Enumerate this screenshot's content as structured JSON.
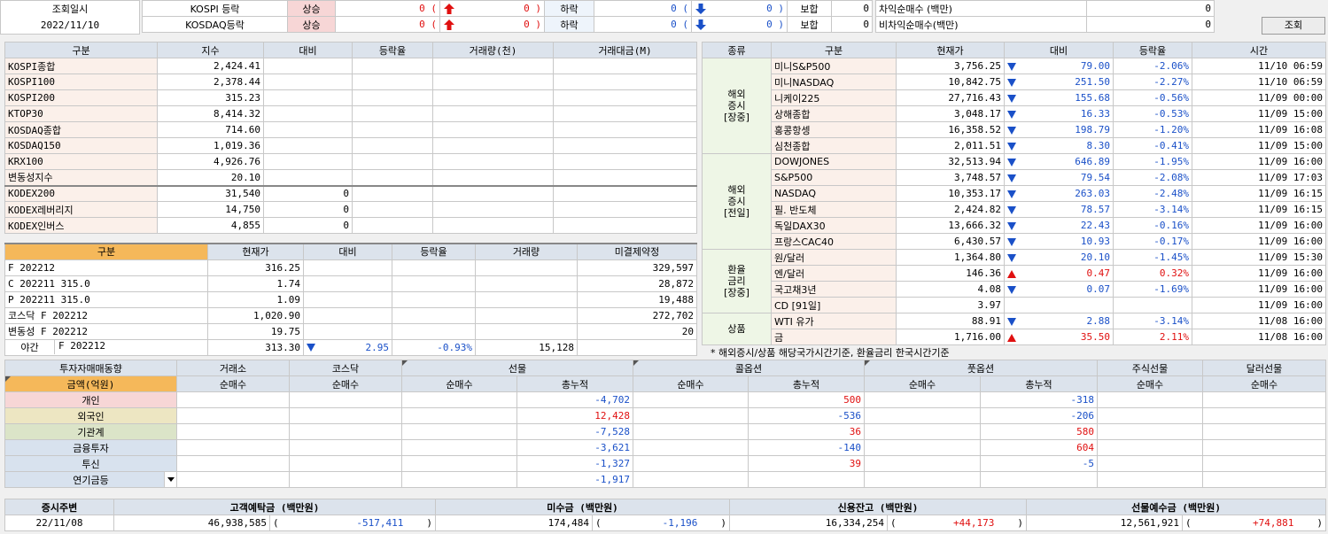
{
  "header": {
    "query_label": "조회일시",
    "query_date": "2022/11/10",
    "rows": [
      {
        "name": "KOSPI 등락",
        "up_label": "상승",
        "up": "0 (",
        "up_limit": "0 )",
        "down_label": "하락",
        "down": "0 (",
        "down_limit": "0 )",
        "flat_label": "보합",
        "flat": "0"
      },
      {
        "name": "KOSDAQ등락",
        "up_label": "상승",
        "up": "0 (",
        "up_limit": "0 )",
        "down_label": "하락",
        "down": "0 (",
        "down_limit": "0 )",
        "flat_label": "보합",
        "flat": "0"
      }
    ],
    "arb": [
      {
        "label": "차익순매수 (백만)",
        "value": "0"
      },
      {
        "label": "비차익순매수(백만)",
        "value": "0"
      }
    ],
    "query_button": "조회"
  },
  "index_table": {
    "headers": [
      "구분",
      "지수",
      "대비",
      "등락율",
      "거래량(천)",
      "거래대금(M)"
    ],
    "rows": [
      [
        "KOSPI종합",
        "2,424.41",
        "",
        "",
        "",
        ""
      ],
      [
        "KOSPI100",
        "2,378.44",
        "",
        "",
        "",
        ""
      ],
      [
        "KOSPI200",
        "315.23",
        "",
        "",
        "",
        ""
      ],
      [
        "KTOP30",
        "8,414.32",
        "",
        "",
        "",
        ""
      ],
      [
        "KOSDAQ종합",
        "714.60",
        "",
        "",
        "",
        ""
      ],
      [
        "KOSDAQ150",
        "1,019.36",
        "",
        "",
        "",
        ""
      ],
      [
        "KRX100",
        "4,926.76",
        "",
        "",
        "",
        ""
      ],
      [
        "변동성지수",
        "20.10",
        "",
        "",
        "",
        ""
      ],
      [
        "KODEX200",
        "31,540",
        "0",
        "",
        "",
        ""
      ],
      [
        "KODEX레버리지",
        "14,750",
        "0",
        "",
        "",
        ""
      ],
      [
        "KODEX인버스",
        "4,855",
        "0",
        "",
        "",
        ""
      ]
    ]
  },
  "futures_table": {
    "headers": [
      "구분",
      "현재가",
      "대비",
      "등락율",
      "거래량",
      "미결제약정"
    ],
    "rows": [
      [
        "F 202212",
        "316.25",
        "",
        "",
        "",
        "329,597"
      ],
      [
        "C 202211 315.0",
        "1.74",
        "",
        "",
        "",
        "28,872"
      ],
      [
        "P 202211 315.0",
        "1.09",
        "",
        "",
        "",
        "19,488"
      ],
      [
        "코스닥 F 202212",
        "1,020.90",
        "",
        "",
        "",
        "272,702"
      ],
      [
        "변동성 F 202212",
        "19.75",
        "",
        "",
        "",
        "20"
      ]
    ],
    "night": {
      "label": "야간",
      "code": "F 202212",
      "price": "313.30",
      "change": "2.95",
      "rate": "-0.93%",
      "volume": "15,128"
    }
  },
  "world_table": {
    "headers": [
      "종류",
      "구분",
      "현재가",
      "대비",
      "등락율",
      "시간"
    ],
    "groups": [
      {
        "label": [
          "해외",
          "증시",
          "[장중]"
        ],
        "rows": [
          [
            "미니S&P500",
            "3,756.25",
            "down",
            "79.00",
            "-2.06%",
            "11/10 06:59"
          ],
          [
            "미니NASDAQ",
            "10,842.75",
            "down",
            "251.50",
            "-2.27%",
            "11/10 06:59"
          ],
          [
            "니케이225",
            "27,716.43",
            "down",
            "155.68",
            "-0.56%",
            "11/09 00:00"
          ],
          [
            "상해종합",
            "3,048.17",
            "down",
            "16.33",
            "-0.53%",
            "11/09 15:00"
          ],
          [
            "홍콩항셍",
            "16,358.52",
            "down",
            "198.79",
            "-1.20%",
            "11/09 16:08"
          ],
          [
            "심천종합",
            "2,011.51",
            "down",
            "8.30",
            "-0.41%",
            "11/09 15:00"
          ]
        ]
      },
      {
        "label": [
          "해외",
          "증시",
          "[전일]"
        ],
        "rows": [
          [
            "DOWJONES",
            "32,513.94",
            "down",
            "646.89",
            "-1.95%",
            "11/09 16:00"
          ],
          [
            "S&P500",
            "3,748.57",
            "down",
            "79.54",
            "-2.08%",
            "11/09 17:03"
          ],
          [
            "NASDAQ",
            "10,353.17",
            "down",
            "263.03",
            "-2.48%",
            "11/09 16:15"
          ],
          [
            "필. 반도체",
            "2,424.82",
            "down",
            "78.57",
            "-3.14%",
            "11/09 16:15"
          ],
          [
            "독일DAX30",
            "13,666.32",
            "down",
            "22.43",
            "-0.16%",
            "11/09 16:00"
          ],
          [
            "프랑스CAC40",
            "6,430.57",
            "down",
            "10.93",
            "-0.17%",
            "11/09 16:00"
          ]
        ]
      },
      {
        "label": [
          "환율",
          "금리",
          "[장중]"
        ],
        "rows": [
          [
            "원/달러",
            "1,364.80",
            "down",
            "20.10",
            "-1.45%",
            "11/09 15:30"
          ],
          [
            "엔/달러",
            "146.36",
            "up",
            "0.47",
            "0.32%",
            "11/09 16:00"
          ],
          [
            "국고채3년",
            "4.08",
            "down",
            "0.07",
            "-1.69%",
            "11/09 16:00"
          ],
          [
            "CD [91일]",
            "3.97",
            "",
            "",
            "",
            "11/09 16:00"
          ]
        ]
      },
      {
        "label": [
          "상품"
        ],
        "rows": [
          [
            "WTI 유가",
            "88.91",
            "down",
            "2.88",
            "-3.14%",
            "11/08 16:00"
          ],
          [
            "금",
            "1,716.00",
            "up",
            "35.50",
            "2.11%",
            "11/08 16:00"
          ]
        ]
      }
    ],
    "footnote": "* 해외증시/상품 해당국가시간기준, 환율금리 한국시간기준"
  },
  "investor_table": {
    "top_headers": [
      "투자자매매동향",
      "거래소",
      "코스닥",
      "선물",
      "콜옵션",
      "풋옵션",
      "주식선물",
      "달러선물"
    ],
    "sub_headers": [
      "금액(억원)",
      "순매수",
      "순매수",
      "순매수",
      "총누적",
      "순매수",
      "총누적",
      "순매수",
      "총누적",
      "순매수",
      "순매수"
    ],
    "rows": [
      {
        "name": "개인",
        "fut_total": "-4,702",
        "call_total": "500",
        "put_total": "-318"
      },
      {
        "name": "외국인",
        "fut_total": "12,428",
        "call_total": "-536",
        "put_total": "-206"
      },
      {
        "name": "기관계",
        "fut_total": "-7,528",
        "call_total": "36",
        "put_total": "580"
      },
      {
        "name": "금융투자",
        "fut_total": "-3,621",
        "call_total": "-140",
        "put_total": "604"
      },
      {
        "name": "투신",
        "fut_total": "-1,327",
        "call_total": "39",
        "put_total": "-5"
      },
      {
        "name": "연기금등",
        "fut_total": "-1,917",
        "call_total": "",
        "put_total": ""
      }
    ]
  },
  "funds_table": {
    "headers": [
      "증시주변",
      "고객예탁금 (백만원)",
      "미수금 (백만원)",
      "신용잔고 (백만원)",
      "선물예수금 (백만원)"
    ],
    "date": "22/11/08",
    "deposit": "46,938,585",
    "deposit_chg": "-517,411",
    "unpaid": "174,484",
    "unpaid_chg": "-1,196",
    "credit": "16,334,254",
    "credit_chg": "+44,173",
    "futdep": "12,561,921",
    "futdep_chg": "+74,881"
  }
}
